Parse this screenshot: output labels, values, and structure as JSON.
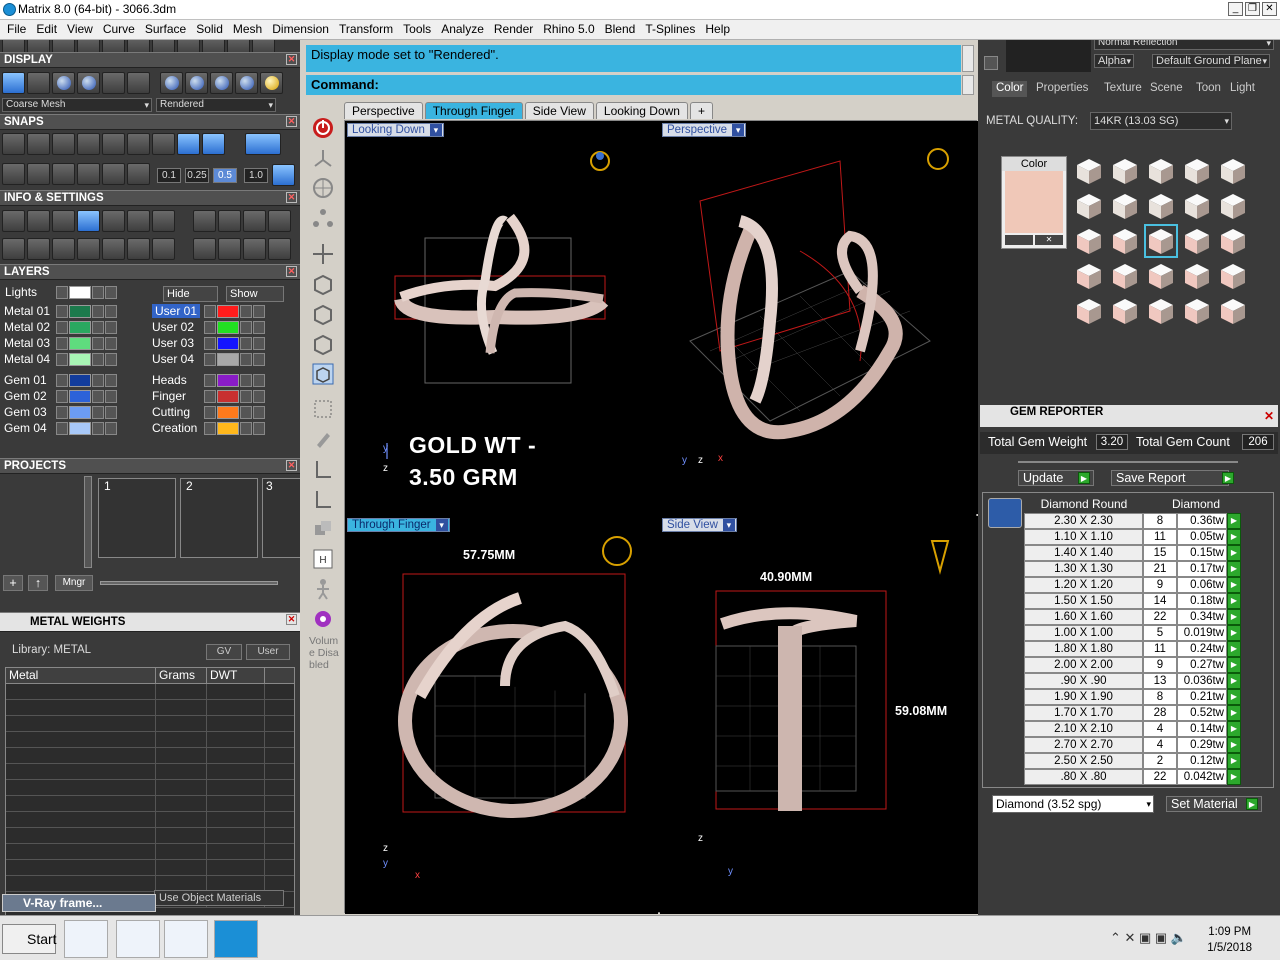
{
  "window": {
    "title": "Matrix 8.0 (64-bit) - 3066.3dm"
  },
  "menu": [
    "File",
    "Edit",
    "View",
    "Curve",
    "Surface",
    "Solid",
    "Mesh",
    "Dimension",
    "Transform",
    "Tools",
    "Analyze",
    "Render",
    "Rhino 5.0",
    "Blend",
    "T-Splines",
    "Help"
  ],
  "display": {
    "title": "DISPLAY",
    "mesh_mode": "Coarse Mesh",
    "render_mode": "Rendered"
  },
  "snaps": {
    "title": "SNAPS",
    "values": [
      "0.1",
      "0.25",
      "0.5",
      "1.0"
    ]
  },
  "info": {
    "title": "INFO & SETTINGS"
  },
  "layers": {
    "title": "LAYERS",
    "lights": "Lights",
    "hide": "Hide",
    "show": "Show",
    "left": [
      {
        "name": "Metal 01",
        "color": "#1c7a4c"
      },
      {
        "name": "Metal 02",
        "color": "#2aa860"
      },
      {
        "name": "Metal 03",
        "color": "#5fdc7e"
      },
      {
        "name": "Metal 04",
        "color": "#a8f5b4"
      },
      {
        "name": "Gem 01",
        "color": "#123c9c"
      },
      {
        "name": "Gem 02",
        "color": "#2c62d8"
      },
      {
        "name": "Gem 03",
        "color": "#6c9cf2"
      },
      {
        "name": "Gem 04",
        "color": "#a8c8f8"
      }
    ],
    "right": [
      {
        "name": "User 01",
        "color": "#ff1c1c"
      },
      {
        "name": "User 02",
        "color": "#22e022"
      },
      {
        "name": "User 03",
        "color": "#1414ff"
      },
      {
        "name": "User 04",
        "color": "#a8a8a8"
      },
      {
        "name": "Heads",
        "color": "#8a1cc8"
      },
      {
        "name": "Finger",
        "color": "#c83030"
      },
      {
        "name": "Cutting",
        "color": "#ff7a1c"
      },
      {
        "name": "Creation",
        "color": "#ffb81c"
      }
    ]
  },
  "projects": {
    "title": "PROJECTS",
    "slots": [
      "1",
      "2",
      "3"
    ],
    "mngr": "Mngr"
  },
  "metal_weights": {
    "title": "METAL WEIGHTS",
    "library": "Library: METAL",
    "gv": "GV",
    "user": "User",
    "cols": [
      "Metal",
      "Grams",
      "DWT"
    ],
    "use_object_materials": "Use Object Materials"
  },
  "vray": {
    "title": "V-Ray frame..."
  },
  "command": {
    "status": "Display mode set to \"Rendered\".",
    "prompt": "Command:"
  },
  "view_tabs": [
    "Perspective",
    "Through Finger",
    "Side View",
    "Looking Down"
  ],
  "view_tabs_active": 1,
  "toolbar_side": {
    "volume_disabled": "Volume Disabled"
  },
  "viewports": {
    "top_left": {
      "label": "Looking Down",
      "gold_line1": "GOLD WT -",
      "gold_line2": "3.50 GRM"
    },
    "top_right": {
      "label": "Perspective"
    },
    "bottom_left": {
      "label": "Through Finger",
      "dim": "57.75MM"
    },
    "bottom_right": {
      "label": "Side View",
      "dim_w": "40.90MM",
      "dim_h": "59.08MM"
    }
  },
  "right_panel": {
    "reflection": "Normal Reflection",
    "alpha": "Alpha",
    "plane": "Default Ground Plane",
    "tabs": [
      "Color",
      "Properties",
      "Texture",
      "Scene",
      "Toon",
      "Light"
    ],
    "metal_quality_label": "METAL QUALITY:",
    "metal_quality_value": "14KR        (13.03 SG)",
    "color_label": "Color",
    "swatch_color": "#f0c8b8"
  },
  "gem_reporter": {
    "title": "GEM REPORTER",
    "total_weight_label": "Total Gem Weight",
    "total_weight": "3.20",
    "total_count_label": "Total Gem Count",
    "total_count": "206",
    "update": "Update",
    "save_report": "Save Report",
    "col_shape": "Diamond Round",
    "col_type": "Diamond",
    "rows": [
      [
        "2.30 X 2.30",
        "8",
        "0.36tw"
      ],
      [
        "1.10 X 1.10",
        "11",
        "0.05tw"
      ],
      [
        "1.40 X 1.40",
        "15",
        "0.15tw"
      ],
      [
        "1.30 X 1.30",
        "21",
        "0.17tw"
      ],
      [
        "1.20 X 1.20",
        "9",
        "0.06tw"
      ],
      [
        "1.50 X 1.50",
        "14",
        "0.18tw"
      ],
      [
        "1.60 X 1.60",
        "22",
        "0.34tw"
      ],
      [
        "1.00 X 1.00",
        "5",
        "0.019tw"
      ],
      [
        "1.80 X 1.80",
        "11",
        "0.24tw"
      ],
      [
        "2.00 X 2.00",
        "9",
        "0.27tw"
      ],
      [
        ".90 X .90",
        "13",
        "0.036tw"
      ],
      [
        "1.90 X 1.90",
        "8",
        "0.21tw"
      ],
      [
        "1.70 X 1.70",
        "28",
        "0.52tw"
      ],
      [
        "2.10 X 2.10",
        "4",
        "0.14tw"
      ],
      [
        "2.70 X 2.70",
        "4",
        "0.29tw"
      ],
      [
        "2.50 X 2.50",
        "2",
        "0.12tw"
      ],
      [
        ".80 X .80",
        "22",
        "0.042tw"
      ]
    ],
    "material": "Diamond    (3.52 spg)",
    "set_material": "Set Material"
  },
  "taskbar": {
    "start": "Start",
    "time": "1:09 PM",
    "date": "1/5/2018"
  }
}
